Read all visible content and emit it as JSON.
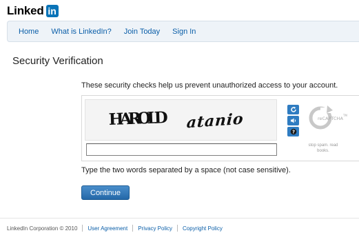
{
  "header": {
    "logo_text": "Linked",
    "logo_badge": "in"
  },
  "nav": {
    "items": [
      {
        "label": "Home"
      },
      {
        "label": "What is LinkedIn?"
      },
      {
        "label": "Join Today"
      },
      {
        "label": "Sign In"
      }
    ]
  },
  "main": {
    "title": "Security Verification",
    "intro": "These security checks help us prevent unauthorized access to your account.",
    "captcha": {
      "word1": "HAROLD",
      "word2": "atanio",
      "input_value": "",
      "buttons": [
        {
          "icon": "refresh-icon"
        },
        {
          "icon": "audio-icon"
        },
        {
          "icon": "help-icon"
        }
      ],
      "brand": "reCAPTCHA",
      "brand_tm": "TM",
      "tagline": "stop spam. read books."
    },
    "instructions": "Type the two words separated by a space (not case sensitive).",
    "continue_label": "Continue"
  },
  "footer": {
    "copyright": "LinkedIn Corporation © 2010",
    "links": [
      {
        "label": "User Agreement"
      },
      {
        "label": "Privacy Policy"
      },
      {
        "label": "Copyright Policy"
      }
    ]
  },
  "colors": {
    "brand_blue": "#0a74b8",
    "link": "#0a5ea8",
    "nav_bg": "#eef3f8",
    "button": "#2468a8"
  }
}
